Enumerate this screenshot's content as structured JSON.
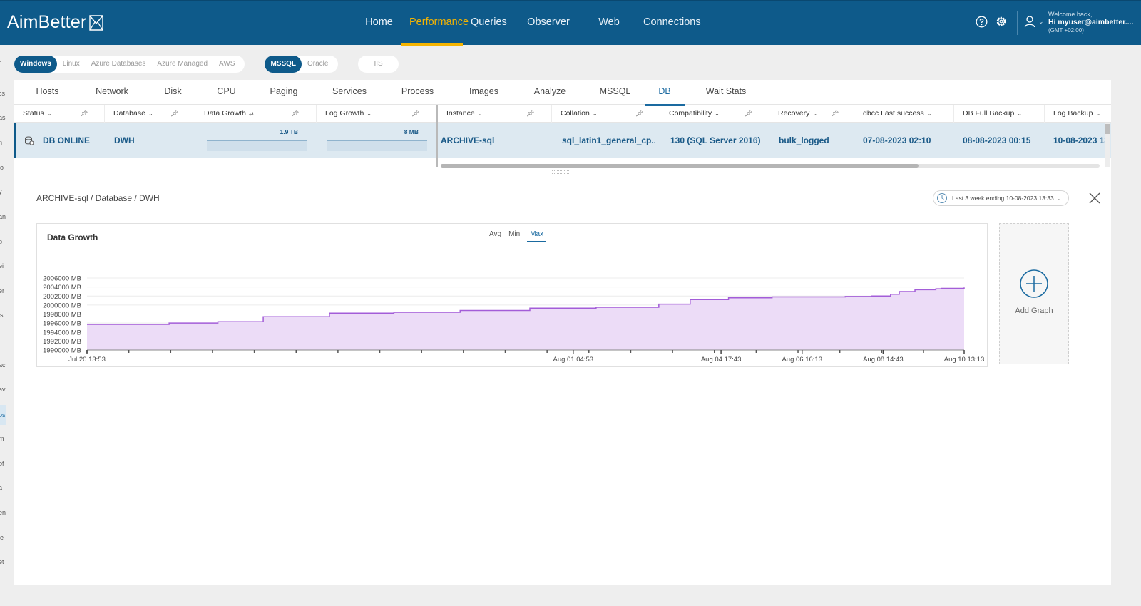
{
  "app": {
    "logo_text": "AimBetter",
    "colors": {
      "brand": "#0e5a8a",
      "active_nav": "#f5b400",
      "accent": "#1a6aa0",
      "chart_line": "#a35dd8",
      "chart_fill": "#ecdcf7"
    }
  },
  "nav": {
    "items": [
      {
        "label": "Home",
        "active": false
      },
      {
        "label": "Performance",
        "active": true
      },
      {
        "label": "Queries",
        "active": false
      },
      {
        "label": "Observer",
        "active": false
      },
      {
        "label": "Web",
        "active": false
      },
      {
        "label": "Connections",
        "active": false
      }
    ],
    "icons": [
      "help-icon",
      "settings-gear-icon",
      "user-icon"
    ]
  },
  "user": {
    "welcome": "Welcome back,",
    "name": "Hi myuser@aimbetter....",
    "timezone": "(GMT +02:00)"
  },
  "sidebar": {
    "items": [
      "r",
      "cs",
      "as",
      "n",
      "lo",
      "y",
      "an",
      "b",
      "ei",
      "er",
      "is",
      "j",
      "ac",
      "av",
      "os",
      "m",
      "of",
      "a",
      "en",
      "ie",
      "et"
    ],
    "active_index": 14
  },
  "filters": {
    "os": [
      {
        "label": "Windows",
        "on": true
      },
      {
        "label": "Linux",
        "on": false
      },
      {
        "label": "Azure Databases",
        "on": false
      },
      {
        "label": "Azure Managed",
        "on": false
      },
      {
        "label": "AWS",
        "on": false
      }
    ],
    "engine": [
      {
        "label": "MSSQL",
        "on": true
      },
      {
        "label": "Oracle",
        "on": false
      }
    ],
    "web": [
      {
        "label": "IIS",
        "on": false
      }
    ]
  },
  "tabs": [
    {
      "label": "Hosts",
      "active": false
    },
    {
      "label": "Network",
      "active": false
    },
    {
      "label": "Disk",
      "active": false
    },
    {
      "label": "CPU",
      "active": false
    },
    {
      "label": "Paging",
      "active": false
    },
    {
      "label": "Services",
      "active": false
    },
    {
      "label": "Process",
      "active": false
    },
    {
      "label": "Images",
      "active": false
    },
    {
      "label": "Analyze",
      "active": false
    },
    {
      "label": "MSSQL",
      "active": false
    },
    {
      "label": "DB",
      "active": true
    },
    {
      "label": "Wait Stats",
      "active": false
    }
  ],
  "grid": {
    "columns": [
      "Status",
      "Database",
      "Data Growth",
      "Log Growth",
      "Instance",
      "Collation",
      "Compatibility",
      "Recovery",
      "dbcc Last success",
      "DB Full Backup",
      "Log Backup"
    ],
    "row": {
      "status": "DB ONLINE",
      "database": "DWH",
      "data_growth": "1.9 TB",
      "log_growth": "8 MB",
      "instance": "ARCHIVE-sql",
      "collation": "sql_latin1_general_cp...",
      "compatibility": "130 (SQL Server 2016)",
      "recovery": "bulk_logged",
      "dbcc_last_success": "07-08-2023 02:10",
      "db_full_backup": "08-08-2023 00:15",
      "log_backup": "10-08-2023 13:"
    }
  },
  "detail": {
    "breadcrumb": "ARCHIVE-sql / Database / DWH",
    "time_range": "Last 3 week ending  10-08-2023 13:33",
    "aggregations": [
      {
        "label": "Avg",
        "on": false
      },
      {
        "label": "Min",
        "on": false
      },
      {
        "label": "Max",
        "on": true
      }
    ],
    "add_graph_label": "Add Graph"
  },
  "chart_data": {
    "type": "area",
    "title": "Data Growth",
    "unit": "MB",
    "ylim": [
      1990000,
      2006000
    ],
    "yticks": [
      1990000,
      1992000,
      1994000,
      1996000,
      1998000,
      2000000,
      2002000,
      2004000,
      2006000
    ],
    "ytick_labels": [
      "1990000 MB",
      "1992000 MB",
      "1994000 MB",
      "1996000 MB",
      "1998000 MB",
      "2000000 MB",
      "2002000 MB",
      "2004000 MB",
      "2006000 MB"
    ],
    "xlim": [
      "2023-07-20T13:53",
      "2023-08-10T13:13"
    ],
    "xticks": [
      {
        "x": "2023-07-20T13:53",
        "label": "Jul 20 13:53"
      },
      {
        "x": "2023-08-01T04:53",
        "label": "Aug 01 04:53"
      },
      {
        "x": "2023-08-04T17:43",
        "label": "Aug 04 17:43"
      },
      {
        "x": "2023-08-06T16:13",
        "label": "Aug 06 16:13"
      },
      {
        "x": "2023-08-08T14:43",
        "label": "Aug 08 14:43"
      },
      {
        "x": "2023-08-10T13:13",
        "label": "Aug 10 13:13"
      }
    ],
    "grid": true,
    "series": [
      {
        "step": true,
        "points": [
          {
            "x": "2023-07-20T13:53",
            "y": 1995700
          },
          {
            "x": "2023-07-22T13:00",
            "y": 1996000
          },
          {
            "x": "2023-07-23T17:00",
            "y": 1996300
          },
          {
            "x": "2023-07-24T19:00",
            "y": 1997400
          },
          {
            "x": "2023-07-26T09:00",
            "y": 1998200
          },
          {
            "x": "2023-07-27T22:00",
            "y": 1998400
          },
          {
            "x": "2023-07-29T12:00",
            "y": 1998800
          },
          {
            "x": "2023-07-31T04:00",
            "y": 1999300
          },
          {
            "x": "2023-08-01T18:00",
            "y": 1999500
          },
          {
            "x": "2023-08-03T06:00",
            "y": 2000200
          },
          {
            "x": "2023-08-04T00:00",
            "y": 2001200
          },
          {
            "x": "2023-08-04T22:00",
            "y": 2001600
          },
          {
            "x": "2023-08-05T23:00",
            "y": 2001800
          },
          {
            "x": "2023-08-07T17:00",
            "y": 2001900
          },
          {
            "x": "2023-08-08T08:00",
            "y": 2002000
          },
          {
            "x": "2023-08-08T19:00",
            "y": 2002400
          },
          {
            "x": "2023-08-09T00:00",
            "y": 2003000
          },
          {
            "x": "2023-08-09T09:00",
            "y": 2003400
          },
          {
            "x": "2023-08-09T21:00",
            "y": 2003600
          },
          {
            "x": "2023-08-10T00:00",
            "y": 2003700
          },
          {
            "x": "2023-08-10T13:13",
            "y": 2003900
          }
        ]
      }
    ]
  }
}
